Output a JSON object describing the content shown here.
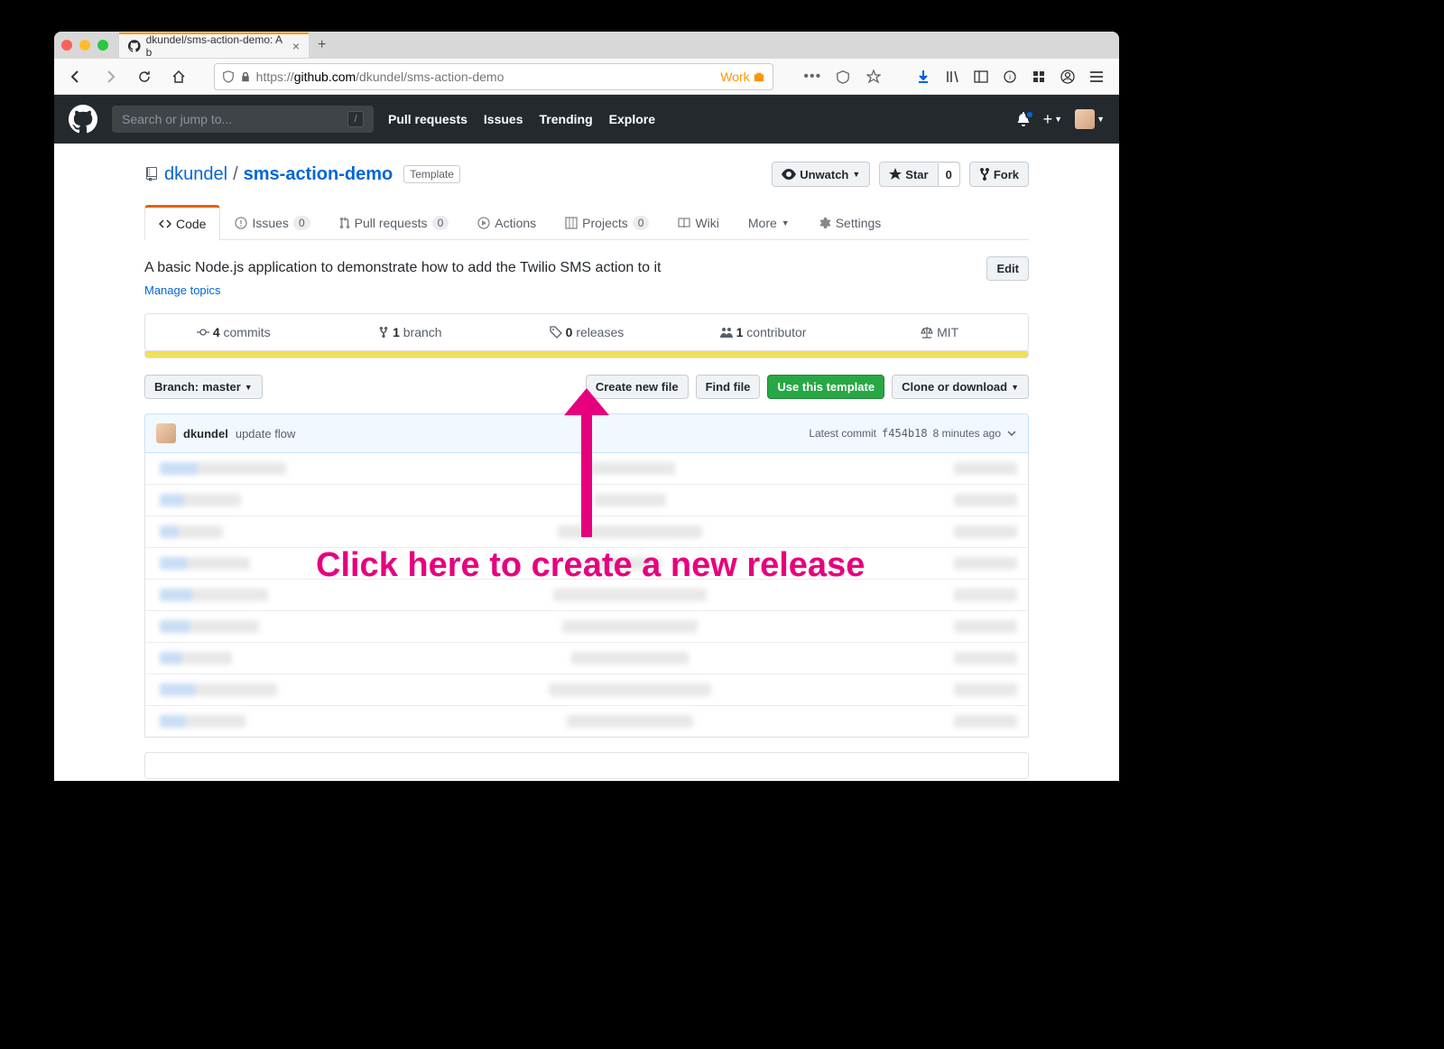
{
  "browser": {
    "tab_title": "dkundel/sms-action-demo: A b",
    "url_prefix": "https://",
    "url_domain": "github.com",
    "url_path": "/dkundel/sms-action-demo",
    "container_tag": "Work"
  },
  "github": {
    "search_placeholder": "Search or jump to...",
    "nav": {
      "pull_requests": "Pull requests",
      "issues": "Issues",
      "trending": "Trending",
      "explore": "Explore"
    }
  },
  "repo": {
    "owner": "dkundel",
    "name": "sms-action-demo",
    "template_label": "Template",
    "actions": {
      "unwatch": "Unwatch",
      "star": "Star",
      "star_count": "0",
      "fork": "Fork"
    },
    "tabs": {
      "code": "Code",
      "issues": "Issues",
      "issues_count": "0",
      "pulls": "Pull requests",
      "pulls_count": "0",
      "actions": "Actions",
      "projects": "Projects",
      "projects_count": "0",
      "wiki": "Wiki",
      "more": "More",
      "settings": "Settings"
    },
    "description": "A basic Node.js application to demonstrate how to add the Twilio SMS action to it",
    "manage_topics": "Manage topics",
    "edit": "Edit",
    "summary": {
      "commits_count": "4",
      "commits_label": "commits",
      "branches_count": "1",
      "branches_label": "branch",
      "releases_count": "0",
      "releases_label": "releases",
      "contributors_count": "1",
      "contributors_label": "contributor",
      "license": "MIT"
    },
    "branch_label": "Branch:",
    "branch": "master",
    "create_file": "Create new file",
    "find_file": "Find file",
    "use_template": "Use this template",
    "clone": "Clone or download",
    "latest_commit": {
      "author": "dkundel",
      "message": "update flow",
      "label": "Latest commit",
      "sha": "f454b18",
      "time": "8 minutes ago"
    }
  },
  "annotation": "Click here to create a new release"
}
